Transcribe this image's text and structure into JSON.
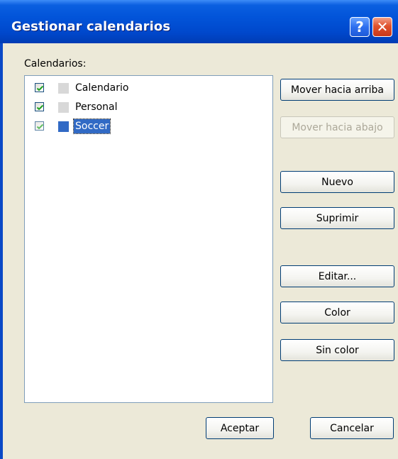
{
  "window": {
    "title": "Gestionar calendarios",
    "help_glyph": "?",
    "close_glyph": "✕"
  },
  "calendars_label": "Calendarios:",
  "calendars": [
    {
      "label": "Calendario",
      "checked": true,
      "color": "#d8d8d8",
      "selected": false
    },
    {
      "label": "Personal",
      "checked": true,
      "color": "#d8d8d8",
      "selected": false
    },
    {
      "label": "Soccer",
      "checked": true,
      "color": "#316ac5",
      "selected": true
    }
  ],
  "buttons": {
    "move_up": "Mover hacia arriba",
    "move_down": "Mover hacia abajo",
    "new": "Nuevo",
    "delete": "Suprimir",
    "edit": "Editar...",
    "color": "Color",
    "no_color": "Sin color",
    "accept": "Aceptar",
    "cancel": "Cancelar"
  },
  "icons": {
    "help": "help-icon",
    "close": "close-icon",
    "checkbox": "checkmark-icon"
  }
}
